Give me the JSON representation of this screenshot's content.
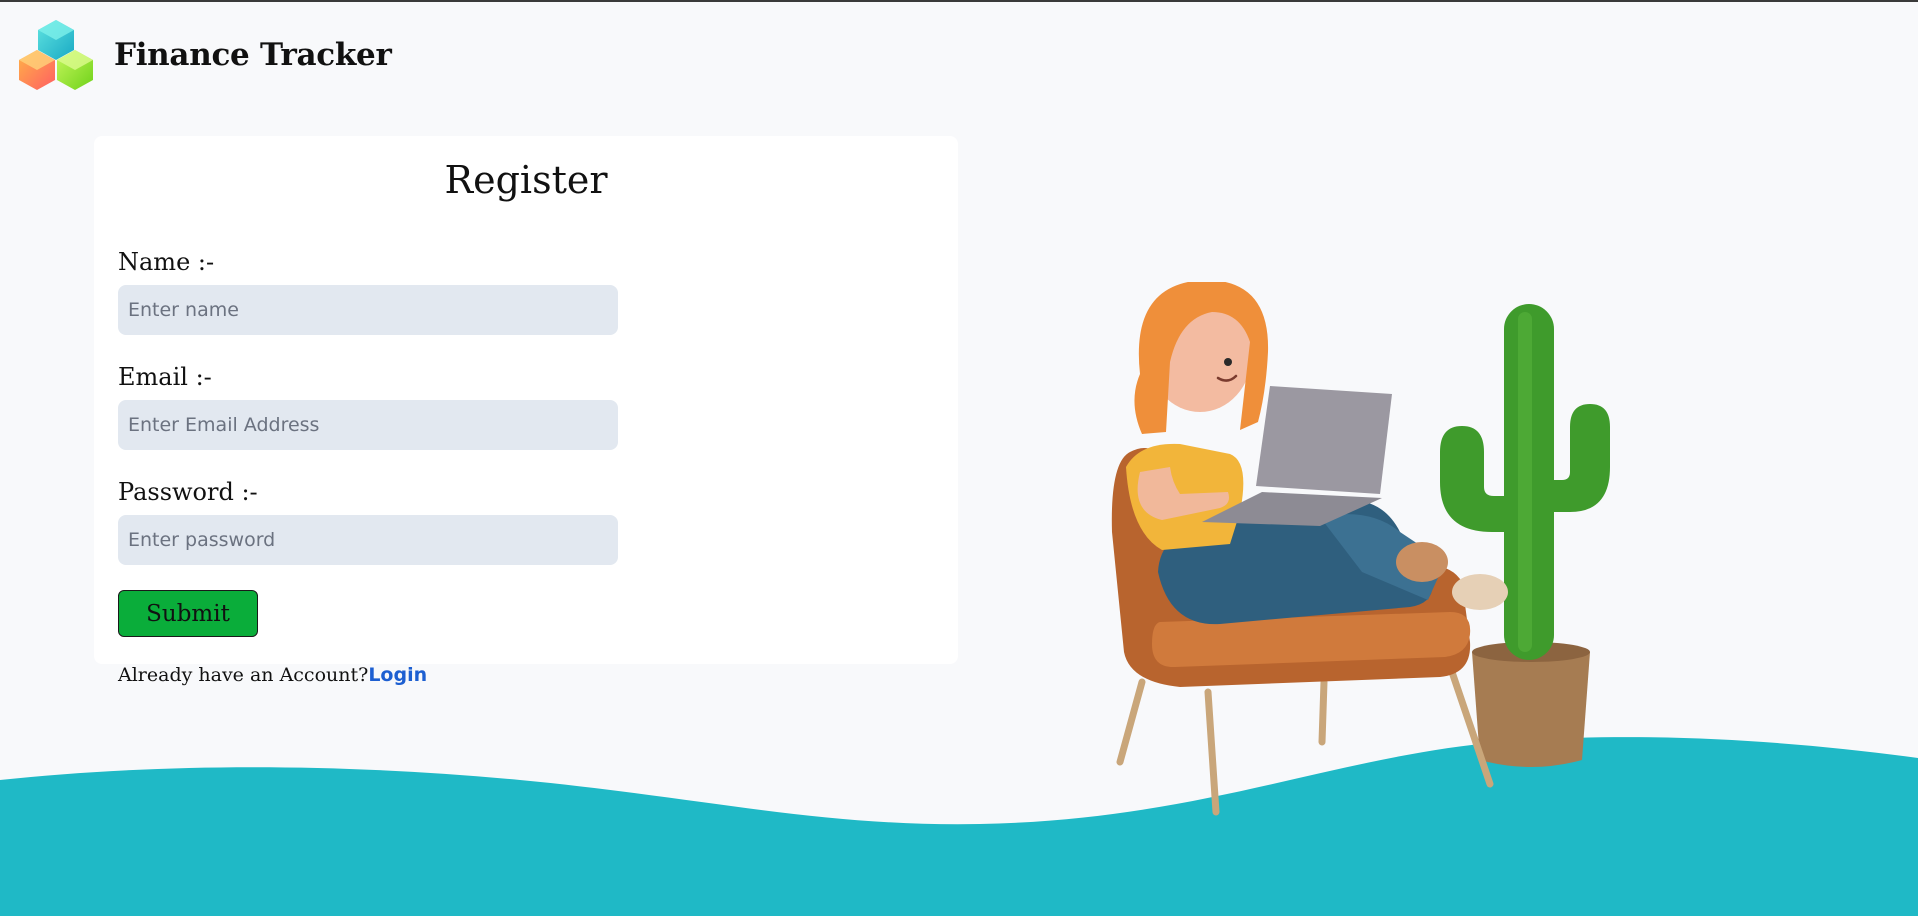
{
  "app": {
    "title": "Finance Tracker",
    "logo_icon": "cubes-logo-icon"
  },
  "form": {
    "title": "Register",
    "fields": [
      {
        "label": "Name :-",
        "placeholder": "Enter name",
        "value": ""
      },
      {
        "label": "Email :-",
        "placeholder": "Enter Email Address",
        "value": ""
      },
      {
        "label": "Password :-",
        "placeholder": "Enter password",
        "value": ""
      }
    ],
    "submit_label": "Submit",
    "login_prompt": "Already have an Account?",
    "login_link": "Login"
  },
  "illustration": {
    "icon": "woman-on-laptop-with-cactus-illustration"
  },
  "colors": {
    "accent_wave": "#1fb9c6",
    "submit": "#0aad3a",
    "link": "#1d5fd1",
    "input_bg": "#e2e8f0"
  }
}
